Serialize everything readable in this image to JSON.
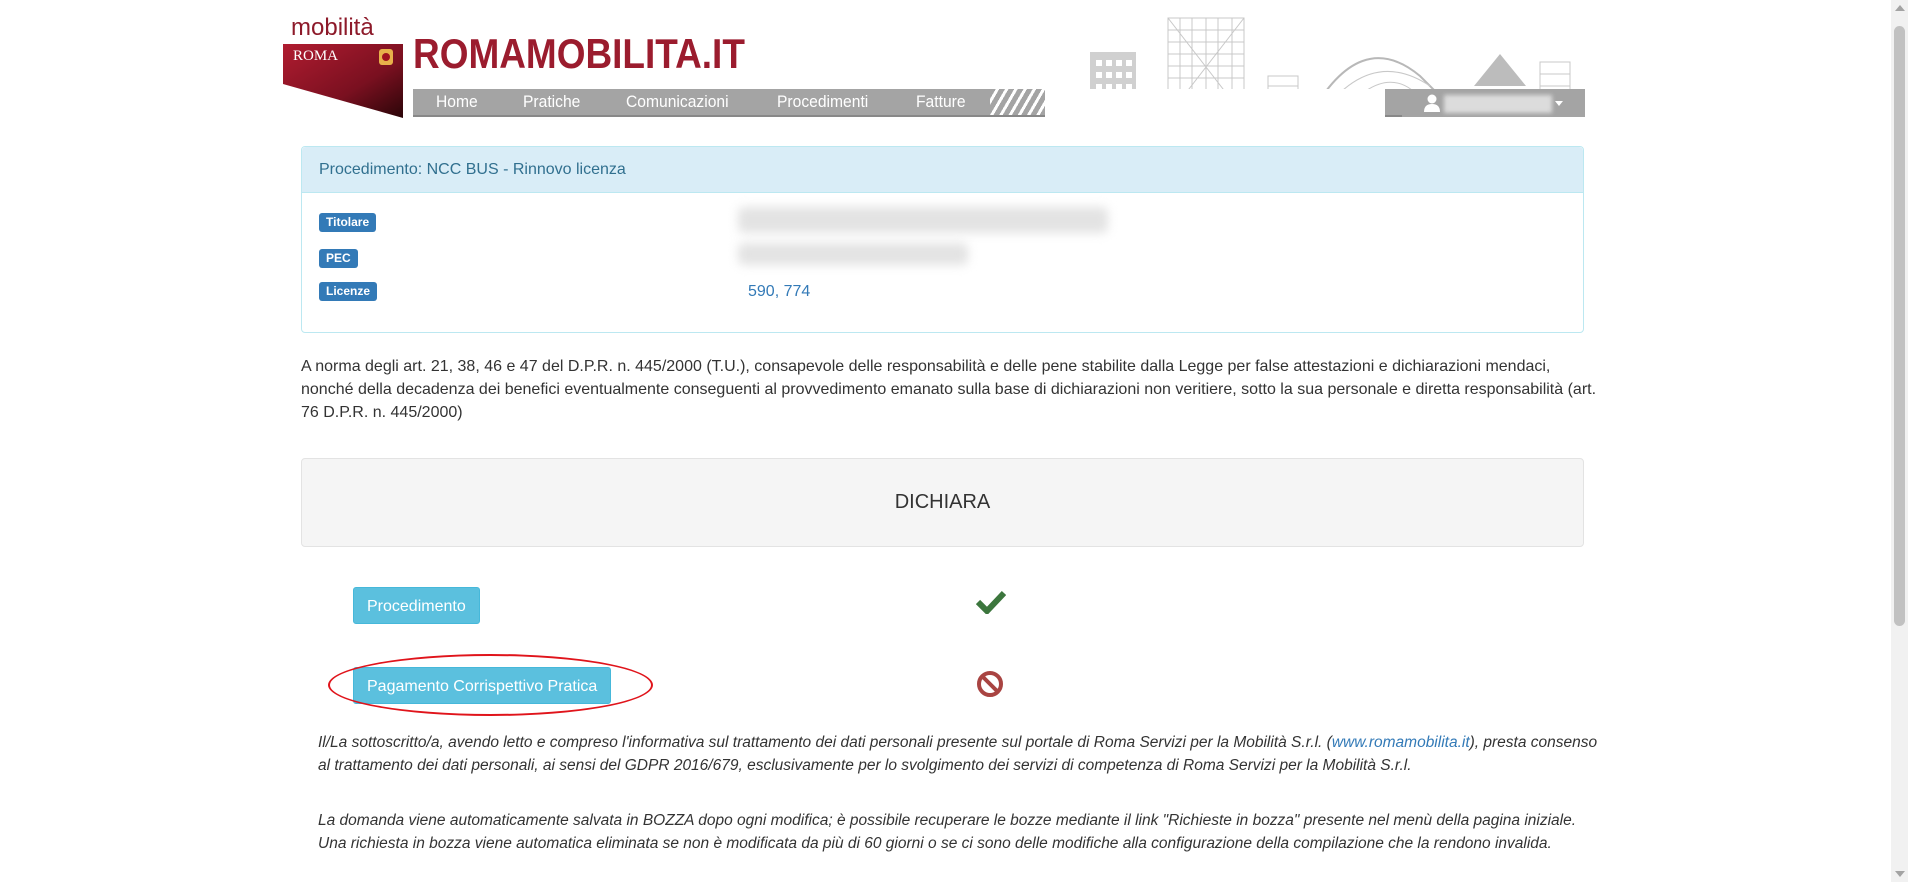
{
  "header": {
    "logo_top": "mobilità",
    "logo_roma": "ROMA",
    "site_title": "ROMAMOBILITA.IT",
    "nav": [
      {
        "label": "Home"
      },
      {
        "label": "Pratiche"
      },
      {
        "label": "Comunicazioni"
      },
      {
        "label": "Procedimenti"
      },
      {
        "label": "Fatture"
      }
    ],
    "user_icon": "user-icon"
  },
  "panel": {
    "title": "Procedimento: NCC BUS - Rinnovo licenza",
    "titolare_label": "Titolare",
    "pec_label": "PEC",
    "licenze_label": "Licenze",
    "licenze_value": "590, 774"
  },
  "norma_text": "A norma degli art. 21, 38, 46 e 47 del D.P.R. n. 445/2000 (T.U.), consapevole delle responsabilità e delle pene stabilite dalla Legge per false attestazioni e dichiarazioni mendaci, nonché della decadenza dei benefici eventualmente conseguenti al provvedimento emanato sulla base di dichiarazioni non veritiere, sotto la sua personale e diretta responsabilità (art. 76 D.P.R. n. 445/2000)",
  "dichiara": "DICHIARA",
  "steps": [
    {
      "label": "Procedimento",
      "status": "complete",
      "icon": "check-icon",
      "color": "#3c763d"
    },
    {
      "label": "Pagamento Corrispettivo Pratica",
      "status": "blocked",
      "icon": "ban-icon",
      "color": "#a94442"
    }
  ],
  "privacy": {
    "before": "Il/La sottoscritto/a, avendo letto e compreso l'informativa sul trattamento dei dati personali presente sul portale di Roma Servizi per la Mobilità S.r.l. (",
    "link": "www.romamobilita.it",
    "after": "), presta consenso al trattamento dei dati personali, ai sensi del GDPR 2016/679, esclusivamente per lo svolgimento dei servizi di competenza di Roma Servizi per la Mobilità S.r.l."
  },
  "bozza_line1": "La domanda viene automaticamente salvata in BOZZA dopo ogni modifica; è possibile recuperare le bozze mediante il link \"Richieste in bozza\" presente nel menù della pagina iniziale.",
  "bozza_line2": "Una richiesta in bozza viene automatica eliminata se non è modificata da più di 60 giorni o se ci sono delle modifiche alla configurazione della compilazione che la rendono invalida.",
  "colors": {
    "brand": "#9b1c2e",
    "info": "#5bc0de",
    "primary": "#337ab7",
    "annotation": "#e0141b"
  }
}
